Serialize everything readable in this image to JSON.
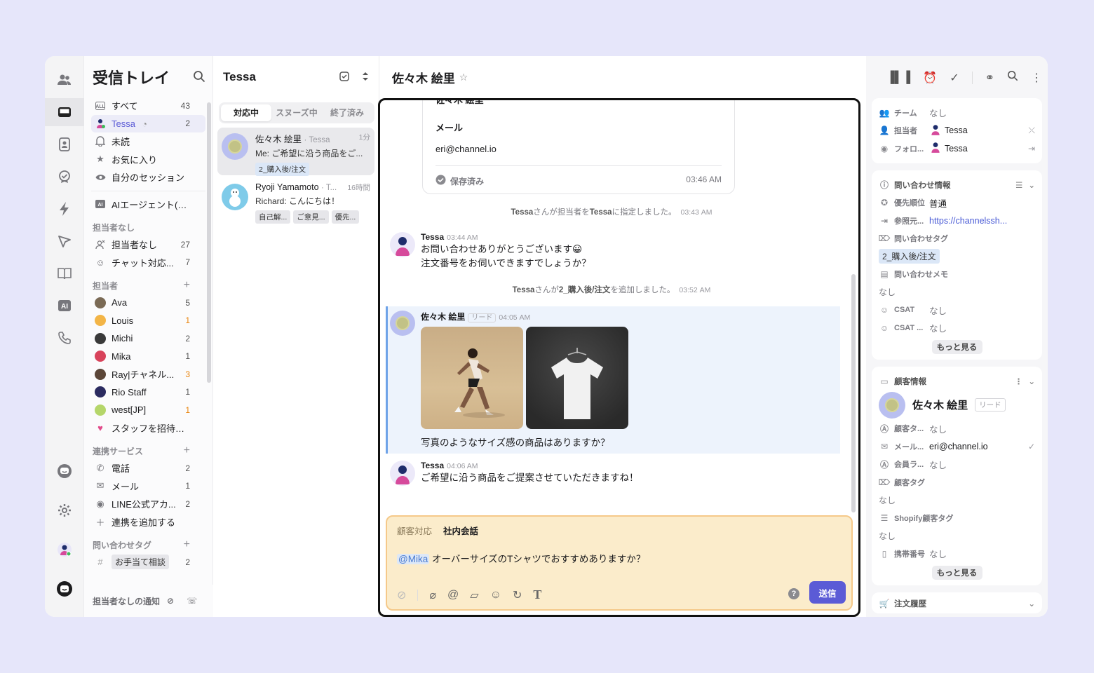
{
  "sidebar": {
    "title": "受信トレイ",
    "items": [
      {
        "label": "すべて",
        "count": "43"
      },
      {
        "label": "Tessa",
        "count": "2"
      },
      {
        "label": "未読"
      },
      {
        "label": "お気に入り"
      },
      {
        "label": "自分のセッション"
      },
      {
        "label": "AIエージェント(A..."
      }
    ],
    "unassigned_header": "担当者なし",
    "unassigned": [
      {
        "label": "担当者なし",
        "count": "27"
      },
      {
        "label": "チャット対応...",
        "count": "7"
      }
    ],
    "assignee_header": "担当者",
    "assignees": [
      {
        "label": "Ava",
        "count": "5",
        "color": "#7a6a55"
      },
      {
        "label": "Louis",
        "count": "1",
        "color": "#f3b547"
      },
      {
        "label": "Michi",
        "count": "2",
        "color": "#3a3a3a"
      },
      {
        "label": "Mika",
        "count": "1",
        "color": "#d8435b"
      },
      {
        "label": "Ray|チャネル...",
        "count": "3",
        "color": "#5b4638"
      },
      {
        "label": "Rio Staff",
        "count": "1",
        "color": "#2b2b60"
      },
      {
        "label": "west[JP]",
        "count": "1",
        "color": "#b5d66a"
      }
    ],
    "invite_label": "スタッフを招待する",
    "integrations_header": "連携サービス",
    "integrations": [
      {
        "label": "電話",
        "count": "2"
      },
      {
        "label": "メール",
        "count": "1"
      },
      {
        "label": "LINE公式アカ...",
        "count": "2"
      }
    ],
    "add_integration": "連携を追加する",
    "tags_header": "問い合わせタグ",
    "tags": [
      {
        "label": "お手当て相談",
        "count": "2"
      }
    ],
    "footer": "担当者なしの通知"
  },
  "list": {
    "title": "Tessa",
    "tabs": [
      "対応中",
      "スヌーズ中",
      "終了済み"
    ],
    "conversations": [
      {
        "name": "佐々木 絵里",
        "sub": "· Tessa",
        "time": "1分",
        "msg": "Me: ご希望に沿う商品をご...",
        "tags": [
          "2_購入後/注文"
        ]
      },
      {
        "name": "Ryoji Yamamoto",
        "sub": "· T...",
        "time": "16時間",
        "msg": "Richard: こんにちは！",
        "tags": [
          "自己解...",
          "ご意見...",
          "優先..."
        ]
      }
    ]
  },
  "chat": {
    "title": "佐々木 絵里",
    "card": {
      "top": "佐々木 絵里",
      "field_label": "メール",
      "field_value": "eri@channel.io",
      "saved": "保存済み",
      "time": "03:46 AM"
    },
    "sys1": {
      "actor": "Tessa",
      "text1": "さんが担当者を",
      "target": "Tessa",
      "text2": "に指定しました。",
      "time": "03:43 AM"
    },
    "msg1": {
      "name": "Tessa",
      "time": "03:44 AM",
      "line1": "お問い合わせありがとうございます😀",
      "line2": "注文番号をお伺いできますでしょうか？"
    },
    "sys2": {
      "actor": "Tessa",
      "text1": "さんが",
      "target": "2_購入後/注文",
      "text2": "を追加しました。",
      "time": "03:52 AM"
    },
    "msg2": {
      "name": "佐々木 絵里",
      "badge": "リード",
      "time": "04:05 AM",
      "text": "写真のようなサイズ感の商品はありますか？"
    },
    "msg3": {
      "name": "Tessa",
      "time": "04:06 AM",
      "text": "ご希望に沿う商品をご提案させていただきますね！"
    },
    "composer": {
      "tab_customer": "顧客対応",
      "tab_internal": "社内会話",
      "mention": "@Mika",
      "text": " オーバーサイズのTシャツでおすすめありますか？",
      "send": "送信"
    }
  },
  "right": {
    "team_label": "チーム",
    "team_value": "なし",
    "assignee_label": "担当者",
    "assignee_value": "Tessa",
    "follower_label": "フォロ...",
    "follower_value": "Tessa",
    "inquiry_header": "問い合わせ情報",
    "priority_label": "優先順位",
    "priority_value": "普通",
    "referrer_label": "参照元...",
    "referrer_value": "https://channelssh...",
    "inquiry_tag_label": "問い合わせタグ",
    "inquiry_tag_value": "2_購入後/注文",
    "memo_label": "問い合わせメモ",
    "memo_value": "なし",
    "csat_label": "CSAT",
    "csat_value": "なし",
    "csat2_label": "CSAT ...",
    "csat2_value": "なし",
    "more1": "もっと見る",
    "customer_header": "顧客情報",
    "customer_name": "佐々木 絵里",
    "customer_badge": "リード",
    "ctype_label": "顧客タ...",
    "ctype_value": "なし",
    "email_label": "メール...",
    "email_value": "eri@channel.io",
    "member_label": "会員ラ...",
    "member_value": "なし",
    "ctag_label": "顧客タグ",
    "ctag_value": "なし",
    "shopify_label": "Shopify顧客タグ",
    "shopify_value": "なし",
    "phone_label": "携帯番号",
    "phone_value": "なし",
    "more2": "もっと見る",
    "orders_header": "注文履歴"
  }
}
